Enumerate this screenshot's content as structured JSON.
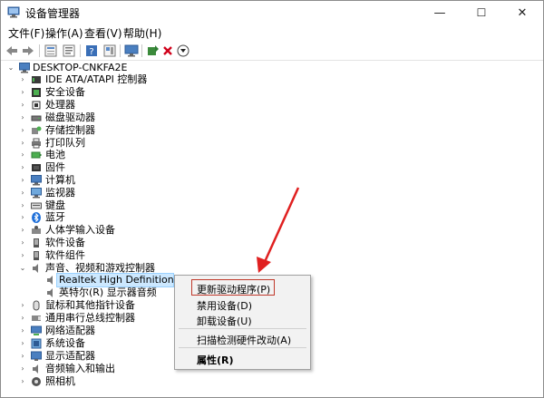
{
  "window": {
    "title": "设备管理器",
    "controls": {
      "minimize": "—",
      "maximize": "☐",
      "close": "✕"
    }
  },
  "menubar": [
    "文件(F)",
    "操作(A)",
    "查看(V)",
    "帮助(H)"
  ],
  "toolbar": {
    "icons": [
      "back-icon",
      "forward-icon",
      "view-icon",
      "properties-icon",
      "help-icon",
      "view2-icon",
      "monitor-icon",
      "update-driver-icon",
      "uninstall-icon",
      "download-icon"
    ]
  },
  "tree": {
    "root": "DESKTOP-CNKFA2E",
    "items": [
      {
        "label": "IDE ATA/ATAPI 控制器",
        "icon": "ide-icon",
        "expanded": false
      },
      {
        "label": "安全设备",
        "icon": "security-icon",
        "expanded": false
      },
      {
        "label": "处理器",
        "icon": "processor-icon",
        "expanded": false
      },
      {
        "label": "磁盘驱动器",
        "icon": "disk-icon",
        "expanded": false
      },
      {
        "label": "存储控制器",
        "icon": "storage-icon",
        "expanded": false
      },
      {
        "label": "打印队列",
        "icon": "printer-icon",
        "expanded": false
      },
      {
        "label": "电池",
        "icon": "battery-icon",
        "expanded": false
      },
      {
        "label": "固件",
        "icon": "firmware-icon",
        "expanded": false
      },
      {
        "label": "计算机",
        "icon": "computer-icon",
        "expanded": false
      },
      {
        "label": "监视器",
        "icon": "monitor-icon",
        "expanded": false
      },
      {
        "label": "键盘",
        "icon": "keyboard-icon",
        "expanded": false
      },
      {
        "label": "蓝牙",
        "icon": "bluetooth-icon",
        "expanded": false
      },
      {
        "label": "人体学输入设备",
        "icon": "hid-icon",
        "expanded": false
      },
      {
        "label": "软件设备",
        "icon": "software-device-icon",
        "expanded": false
      },
      {
        "label": "软件组件",
        "icon": "software-component-icon",
        "expanded": false
      },
      {
        "label": "声音、视频和游戏控制器",
        "icon": "sound-icon",
        "expanded": true,
        "children": [
          "Realtek High Definition Audio",
          "英特尔(R) 显示器音频"
        ]
      },
      {
        "label": "鼠标和其他指针设备",
        "icon": "mouse-icon",
        "expanded": false
      },
      {
        "label": "通用串行总线控制器",
        "icon": "usb-icon",
        "expanded": false
      },
      {
        "label": "网络适配器",
        "icon": "network-icon",
        "expanded": false
      },
      {
        "label": "系统设备",
        "icon": "system-icon",
        "expanded": false
      },
      {
        "label": "显示适配器",
        "icon": "display-icon",
        "expanded": false
      },
      {
        "label": "音频输入和输出",
        "icon": "audio-io-icon",
        "expanded": false
      },
      {
        "label": "照相机",
        "icon": "camera-icon",
        "expanded": false
      }
    ]
  },
  "context_menu": {
    "items": [
      "更新驱动程序(P)",
      "禁用设备(D)",
      "卸载设备(U)",
      "扫描检测硬件改动(A)",
      "属性(R)"
    ],
    "highlight_color": "#c0392b"
  },
  "colors": {
    "selection": "#cce8ff",
    "annotation": "#e02020"
  }
}
